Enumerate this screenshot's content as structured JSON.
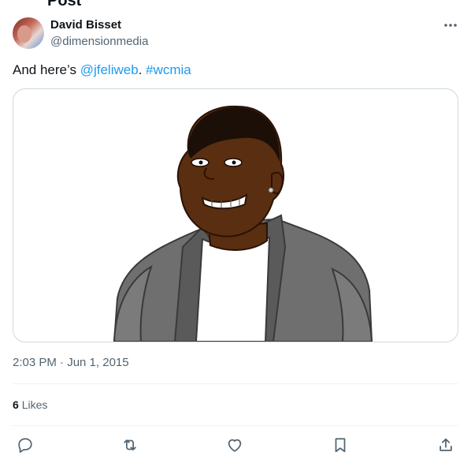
{
  "page_heading": "Post",
  "author": {
    "name": "David Bisset",
    "handle": "@dimensionmedia"
  },
  "tweet": {
    "prefix": "And here’s ",
    "mention": "@jfeliweb",
    "separator": ". ",
    "hashtag": "#wcmia"
  },
  "media": {
    "icon": "cartoon-portrait-image"
  },
  "timestamp": "2:03 PM · Jun 1, 2015",
  "stats": {
    "likes_count": "6",
    "likes_label": "Likes"
  },
  "actions": {
    "reply_icon": "reply-icon",
    "retweet_icon": "retweet-icon",
    "like_icon": "heart-icon",
    "bookmark_icon": "bookmark-icon",
    "share_icon": "share-icon"
  },
  "colors": {
    "link": "#1d9bf0",
    "secondary_text": "#536471",
    "divider": "#eff3f4"
  }
}
